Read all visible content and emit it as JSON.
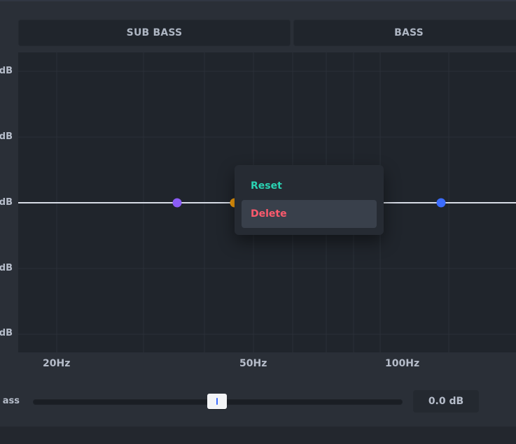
{
  "bands": {
    "sub_bass": "SUB BASS",
    "bass": "BASS"
  },
  "db_axis": {
    "labels": [
      "dB",
      "dB",
      "dB",
      "dB",
      "dB"
    ]
  },
  "freq_axis": {
    "labels": [
      "20Hz",
      "50Hz",
      "100Hz"
    ]
  },
  "context_menu": {
    "reset": "Reset",
    "delete": "Delete"
  },
  "slider": {
    "label": "ass",
    "value_text": "0.0 dB"
  },
  "colors": {
    "accent_purple": "#8b5cf6",
    "accent_orange": "#f59e0b",
    "accent_blue": "#3b6cff",
    "reset_green": "#2ad3b3",
    "delete_red": "#ff5a6d"
  }
}
